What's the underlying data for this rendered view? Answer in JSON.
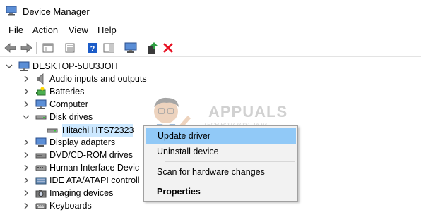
{
  "window": {
    "title": "Device Manager"
  },
  "menu": {
    "file": "File",
    "action": "Action",
    "view": "View",
    "help": "Help"
  },
  "toolbar": {
    "icons": [
      "back-arrow-icon",
      "forward-arrow-icon",
      "show-hide-tree-icon",
      "properties-icon",
      "help-icon",
      "action-pane-icon",
      "monitor-icon",
      "update-driver-icon",
      "uninstall-icon"
    ],
    "colors": {
      "uninstall": "#e81123",
      "help": "#1c5cc8",
      "update": "#2ea043"
    }
  },
  "tree": {
    "root": "DESKTOP-5UU3JOH",
    "items": [
      {
        "label": "Audio inputs and outputs",
        "expanded": false,
        "icon": "speaker-icon"
      },
      {
        "label": "Batteries",
        "expanded": false,
        "icon": "battery-icon"
      },
      {
        "label": "Computer",
        "expanded": false,
        "icon": "computer-icon"
      },
      {
        "label": "Disk drives",
        "expanded": true,
        "icon": "disk-drive-icon"
      },
      {
        "label": "Hitachi HTS72323",
        "child": true,
        "selected": true,
        "icon": "disk-icon"
      },
      {
        "label": "Display adapters",
        "expanded": false,
        "icon": "display-icon"
      },
      {
        "label": "DVD/CD-ROM drives",
        "expanded": false,
        "icon": "dvd-icon"
      },
      {
        "label": "Human Interface Devic",
        "expanded": false,
        "icon": "hid-icon"
      },
      {
        "label": "IDE ATA/ATAPI controll",
        "expanded": false,
        "icon": "ide-icon"
      },
      {
        "label": "Imaging devices",
        "expanded": false,
        "icon": "camera-icon"
      },
      {
        "label": "Keyboards",
        "expanded": false,
        "icon": "keyboard-icon"
      }
    ]
  },
  "context_menu": {
    "items": [
      "Update driver",
      "Uninstall device",
      "Scan for hardware changes",
      "Properties"
    ]
  },
  "watermark": {
    "brand": "APPUALS",
    "tagline_1": "TECH HOW-TO'S FROM",
    "tagline_2": "THE EXPERTS!"
  }
}
